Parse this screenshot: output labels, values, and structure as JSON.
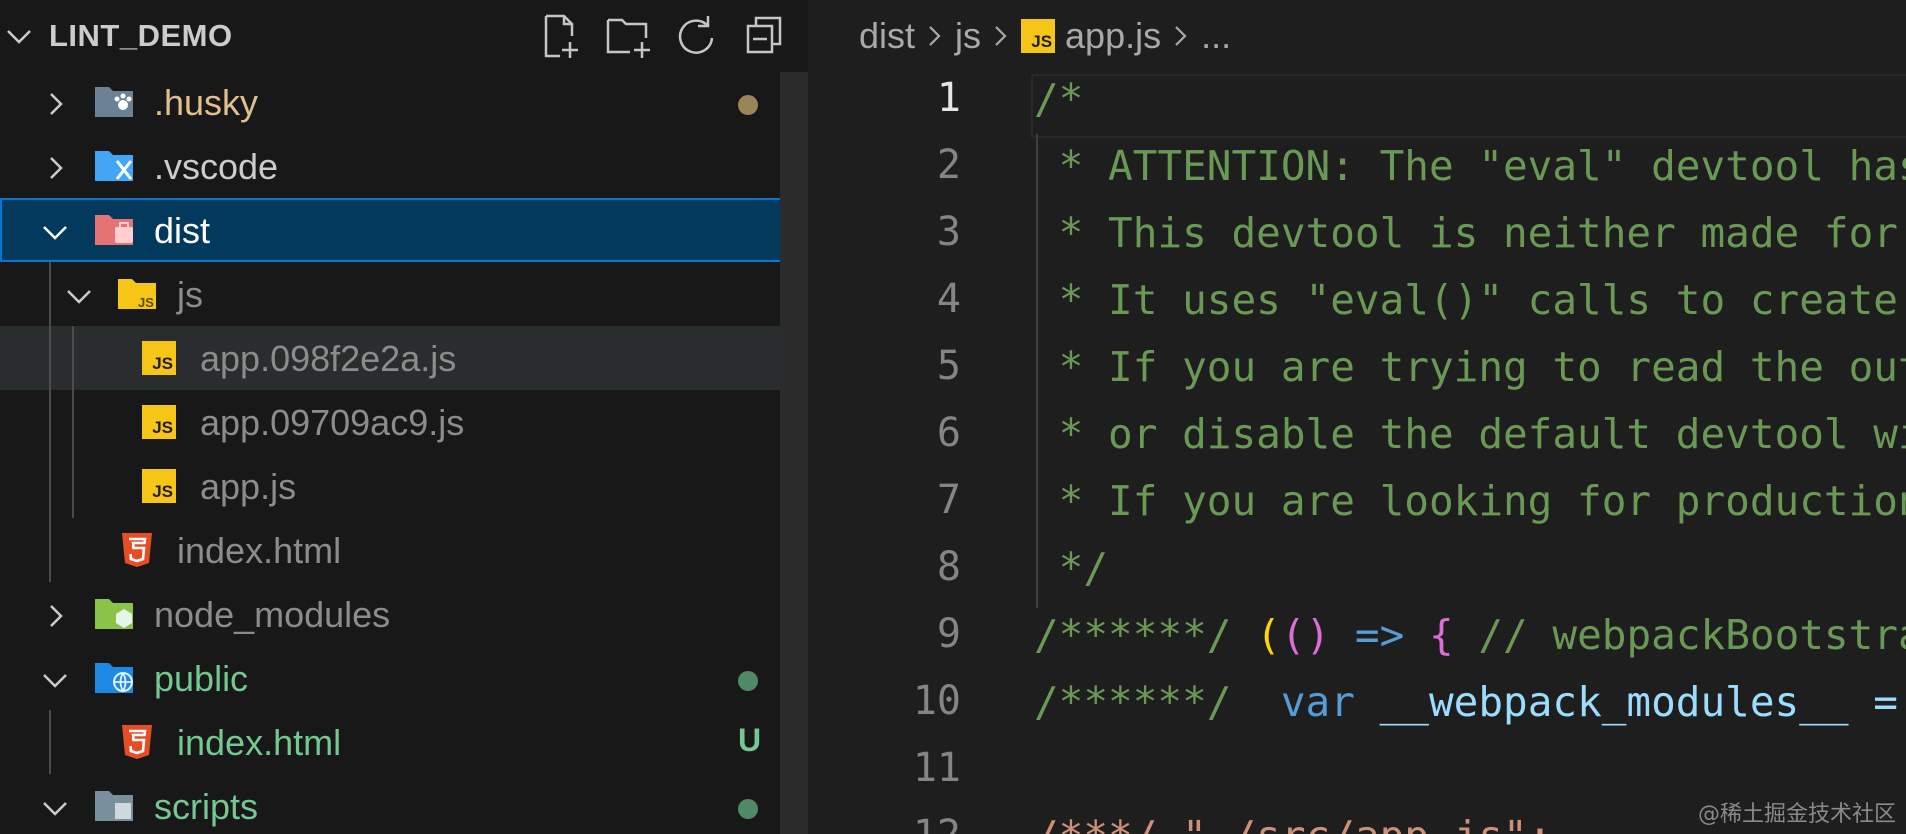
{
  "explorer": {
    "title": "LINT_DEMO",
    "items": [
      {
        "label": ".husky",
        "color": "#e2c08d",
        "status": "dot"
      },
      {
        "label": ".vscode",
        "color": "#cccccc",
        "status": ""
      },
      {
        "label": "dist",
        "color": "#ffffff",
        "status": ""
      },
      {
        "label": "js",
        "color": "#8c8c8c",
        "status": ""
      },
      {
        "label": "app.098f2e2a.js",
        "color": "#8c8c8c",
        "status": ""
      },
      {
        "label": "app.09709ac9.js",
        "color": "#8c8c8c",
        "status": ""
      },
      {
        "label": "app.js",
        "color": "#8c8c8c",
        "status": ""
      },
      {
        "label": "index.html",
        "color": "#8c8c8c",
        "status": ""
      },
      {
        "label": "node_modules",
        "color": "#8c8c8c",
        "status": ""
      },
      {
        "label": "public",
        "color": "#73c991",
        "status": "dot"
      },
      {
        "label": "index.html",
        "color": "#73c991",
        "status": "U"
      },
      {
        "label": "scripts",
        "color": "#73c991",
        "status": "dot"
      }
    ]
  },
  "editor": {
    "breadcrumb": [
      "dist",
      "js",
      "app.js",
      "..."
    ],
    "js_badge": "JS",
    "active_line": "1",
    "lines": [
      {
        "num": "1",
        "text": "/*"
      },
      {
        "num": "2",
        "text": " * ATTENTION: The \"eval\" devtool has been used (maybe by default in mode: \"development\")."
      },
      {
        "num": "3",
        "text": " * This devtool is neither made for production nor for readable output files."
      },
      {
        "num": "4",
        "text": " * It uses \"eval()\" calls to create a separate source file in the browser devtools."
      },
      {
        "num": "5",
        "text": " * If you are trying to read the output file, select a different devtool"
      },
      {
        "num": "6",
        "text": " * or disable the default devtool with \"devtool: false\"."
      },
      {
        "num": "7",
        "text": " * If you are looking for production-ready output files, see mode: \"production\"."
      },
      {
        "num": "8",
        "text": " */"
      },
      {
        "num": "9",
        "text": ""
      },
      {
        "num": "10",
        "text": ""
      },
      {
        "num": "11",
        "text": ""
      },
      {
        "num": "12",
        "text": "/***/ \"./src/app.js\":"
      }
    ],
    "line9": {
      "prefix": "/******/ ",
      "paren_open": "(",
      "args": "()",
      "arrow": " => ",
      "brace": "{",
      "comment": " // webpackBootstrap"
    },
    "line10": {
      "prefix": "/******/  ",
      "keyword": "var",
      "identifier": " __webpack_modules__ = ({"
    }
  },
  "watermark": "@稀土掘金技术社区"
}
